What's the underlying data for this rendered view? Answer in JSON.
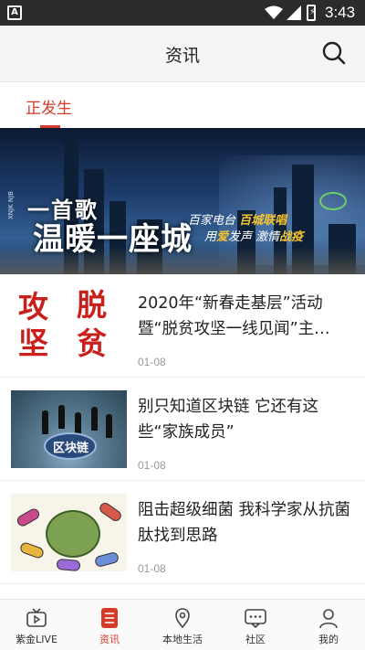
{
  "status_bar": {
    "app_badge": "A",
    "time": "3:43",
    "icons": [
      "wifi-icon",
      "signal-icon",
      "battery-charging-icon"
    ]
  },
  "header": {
    "title": "资讯",
    "search_icon": "search-icon"
  },
  "tabs": [
    {
      "label": "正发生",
      "active": true
    }
  ],
  "banner": {
    "headline_line1": "一首歌",
    "headline_line2": "温暖一座城",
    "tagline_part1": "百家电台",
    "tagline_part2": "百城联唱",
    "tagline2_part1": "用",
    "tagline2_highlight1": "爱",
    "tagline2_part2": "发声  激情",
    "tagline2_highlight2": "战疫",
    "vertical_text": "XNJK NJB"
  },
  "news": [
    {
      "title": "2020年“新春走基层”活动暨“脱贫攻坚一线见闻”主…",
      "date": "01-08",
      "thumb_text": [
        "攻",
        "脱",
        "坚",
        "贫"
      ]
    },
    {
      "title": "别只知道区块链 它还有这些“家族成员”",
      "date": "01-08",
      "thumb_text": [
        "区块链"
      ]
    },
    {
      "title": "阻击超级细菌 我科学家从抗菌肽找到思路",
      "date": "01-08",
      "thumb_text": []
    }
  ],
  "bottom_nav": [
    {
      "label": "紫金LIVE",
      "icon": "tv-icon",
      "active": false
    },
    {
      "label": "资讯",
      "icon": "news-list-icon",
      "active": true
    },
    {
      "label": "本地生活",
      "icon": "location-pin-icon",
      "active": false
    },
    {
      "label": "社区",
      "icon": "chat-bubble-icon",
      "active": false
    },
    {
      "label": "我的",
      "icon": "person-icon",
      "active": false
    }
  ],
  "colors": {
    "accent": "#d63b2a",
    "status_bar_bg": "#2b2b2b",
    "header_bg": "#f5f5f5"
  }
}
